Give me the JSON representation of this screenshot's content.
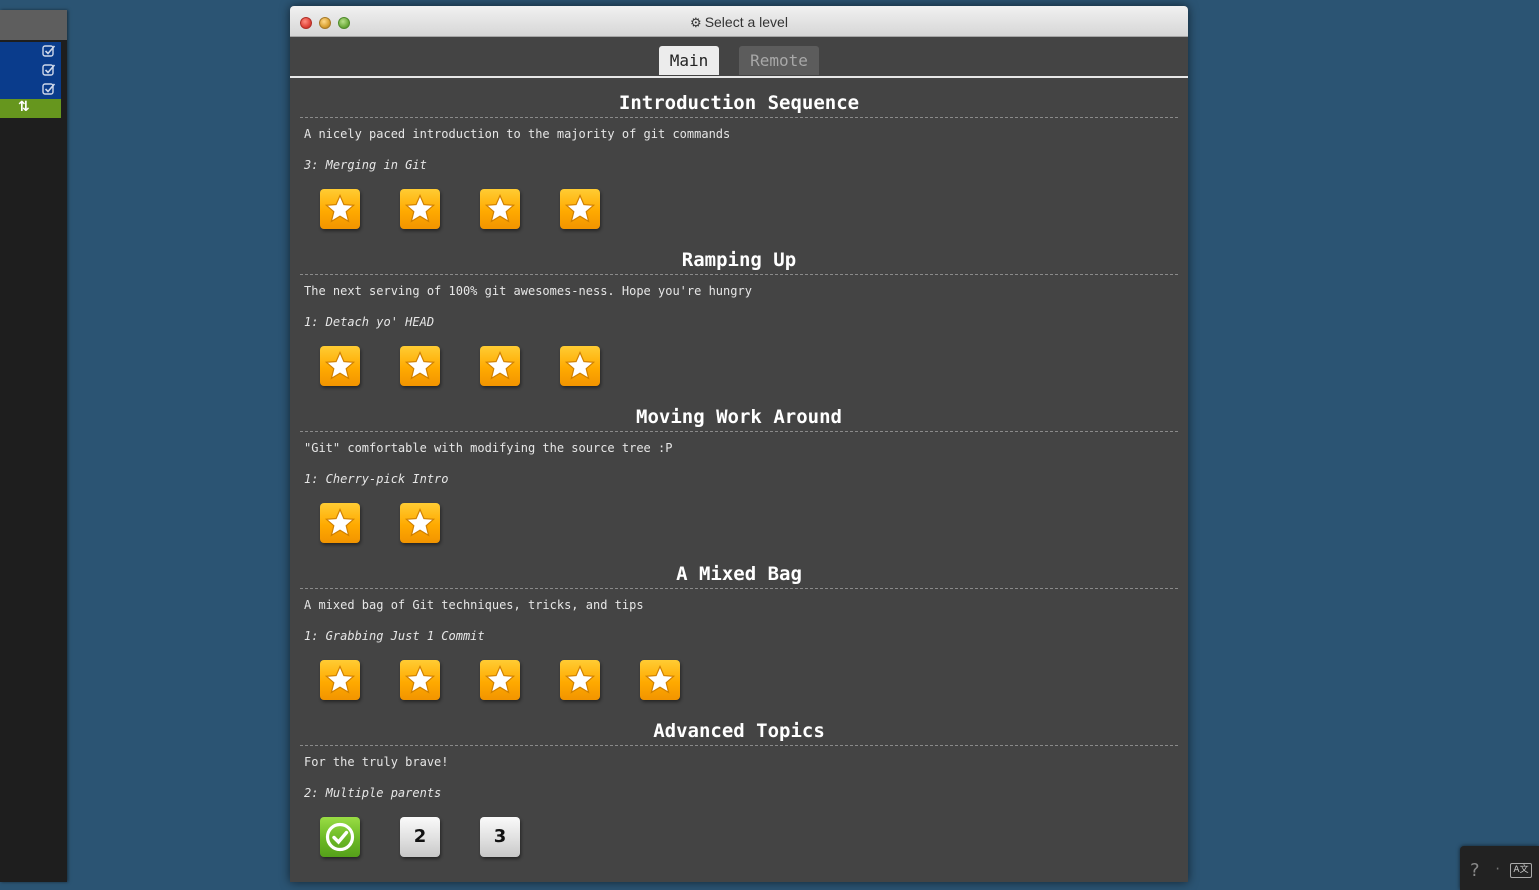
{
  "window": {
    "title": "Select a level",
    "icon": "gear-icon"
  },
  "tabs": [
    {
      "label": "Main",
      "active": true
    },
    {
      "label": "Remote",
      "active": false
    }
  ],
  "sequences": [
    {
      "title": "Introduction Sequence",
      "description": "A nicely paced introduction to the majority of git commands",
      "current": "3: Merging in Git",
      "levels": [
        {
          "status": "solved"
        },
        {
          "status": "solved"
        },
        {
          "status": "solved"
        },
        {
          "status": "solved"
        }
      ]
    },
    {
      "title": "Ramping Up",
      "description": "The next serving of 100% git awesomes-ness. Hope you're hungry",
      "current": "1: Detach yo' HEAD",
      "levels": [
        {
          "status": "solved"
        },
        {
          "status": "solved"
        },
        {
          "status": "solved"
        },
        {
          "status": "solved"
        }
      ]
    },
    {
      "title": "Moving Work Around",
      "description": "\"Git\" comfortable with modifying the source tree :P",
      "current": "1: Cherry-pick Intro",
      "levels": [
        {
          "status": "solved"
        },
        {
          "status": "solved"
        }
      ]
    },
    {
      "title": "A Mixed Bag",
      "description": "A mixed bag of Git techniques, tricks, and tips",
      "current": "1: Grabbing Just 1 Commit",
      "levels": [
        {
          "status": "solved"
        },
        {
          "status": "solved"
        },
        {
          "status": "solved"
        },
        {
          "status": "solved"
        },
        {
          "status": "solved"
        }
      ]
    },
    {
      "title": "Advanced Topics",
      "description": "For the truly brave!",
      "current": "2: Multiple parents",
      "levels": [
        {
          "status": "completed"
        },
        {
          "status": "unsolved",
          "number": "2"
        },
        {
          "status": "unsolved",
          "number": "3"
        }
      ]
    }
  ],
  "help": {
    "question_mark": "?",
    "separator": "·",
    "language_icon": "language-icon"
  },
  "colors": {
    "background": "#2b5473",
    "window": "#444444",
    "star": "#ffaa00",
    "completed": "#6bb825"
  }
}
